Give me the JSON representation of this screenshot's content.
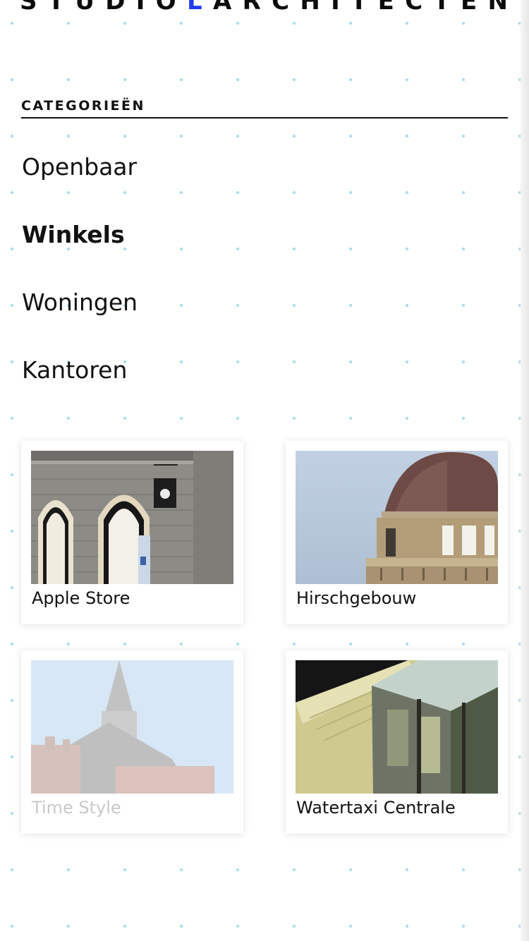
{
  "header": {
    "logo_letters": [
      "S",
      "T",
      "U",
      "D",
      "I",
      "O",
      "L",
      "A",
      "R",
      "C",
      "H",
      "I",
      "T",
      "E",
      "C",
      "T",
      "E",
      "N"
    ],
    "logo_accent_index": 6,
    "accent_color": "#1f3df0"
  },
  "categories": {
    "heading": "CATEGORIEËN",
    "items": [
      {
        "label": "Openbaar",
        "active": false
      },
      {
        "label": "Winkels",
        "active": true
      },
      {
        "label": "Woningen",
        "active": false
      },
      {
        "label": "Kantoren",
        "active": false
      }
    ]
  },
  "projects": [
    {
      "title": "Apple Store",
      "image": "apple-store-facade"
    },
    {
      "title": "Hirschgebouw",
      "image": "dome-building"
    },
    {
      "title": "Time Style",
      "image": "church-tower",
      "faded": true
    },
    {
      "title": "Watertaxi Centrale",
      "image": "glass-pavilion-model"
    }
  ],
  "colors": {
    "dot_grid": "#a9dcf2",
    "text": "#111111",
    "faded_text": "#c9c9c9"
  }
}
